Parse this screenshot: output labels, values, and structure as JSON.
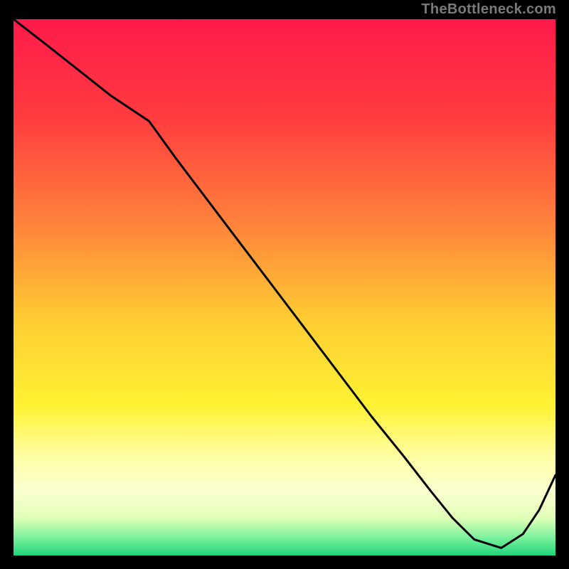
{
  "watermark": "TheBottleneck.com",
  "region_label": "",
  "chart_data": {
    "type": "line",
    "title": "",
    "xlabel": "",
    "ylabel": "",
    "xlim": [
      0,
      1
    ],
    "ylim": [
      0,
      1
    ],
    "background_gradient_stops": [
      {
        "offset": 0.0,
        "color": "#ff1a4b"
      },
      {
        "offset": 0.18,
        "color": "#ff3b3f"
      },
      {
        "offset": 0.38,
        "color": "#ff823b"
      },
      {
        "offset": 0.56,
        "color": "#ffcc33"
      },
      {
        "offset": 0.72,
        "color": "#fff233"
      },
      {
        "offset": 0.82,
        "color": "#ffffa8"
      },
      {
        "offset": 0.88,
        "color": "#fbffd0"
      },
      {
        "offset": 0.93,
        "color": "#e0ffb8"
      },
      {
        "offset": 0.965,
        "color": "#80f29e"
      },
      {
        "offset": 1.0,
        "color": "#1fd67a"
      }
    ],
    "series": [
      {
        "name": "bottleneck-curve",
        "color": "#000000",
        "x": [
          0.0,
          0.06,
          0.12,
          0.18,
          0.25,
          0.3,
          0.36,
          0.42,
          0.48,
          0.54,
          0.6,
          0.66,
          0.72,
          0.77,
          0.81,
          0.85,
          0.9,
          0.94,
          0.97,
          1.0
        ],
        "y": [
          1.0,
          0.953,
          0.905,
          0.857,
          0.81,
          0.74,
          0.66,
          0.58,
          0.5,
          0.42,
          0.34,
          0.26,
          0.185,
          0.12,
          0.07,
          0.03,
          0.014,
          0.04,
          0.085,
          0.15
        ]
      }
    ],
    "region_marker": {
      "x_center": 0.83,
      "y": 0.016
    }
  }
}
